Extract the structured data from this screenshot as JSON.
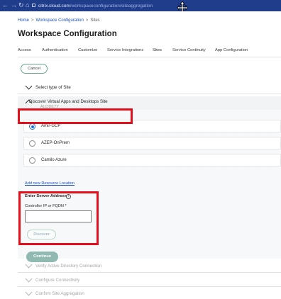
{
  "browser": {
    "url_host": "citrix.cloud.com",
    "url_path": "/workspaceconfiguration/siteaggregation",
    "back_icon": "←",
    "forward_icon": "→",
    "reload_icon": "↻",
    "home_icon": "⌂"
  },
  "breadcrumb": {
    "items": [
      "Home",
      "Workspace Configuration",
      "Sites"
    ],
    "separator": ">"
  },
  "page": {
    "title": "Workspace Configuration",
    "accent_color": "#2f9e7d",
    "highlight_color": "#e3101b"
  },
  "tabs": [
    {
      "label": "Access"
    },
    {
      "label": "Authentication"
    },
    {
      "label": "Customize"
    },
    {
      "label": "Service Integrations"
    },
    {
      "label": "Sites",
      "active": true
    },
    {
      "label": "Service Continuity"
    },
    {
      "label": "App Configuration"
    }
  ],
  "actions": {
    "cancel_label": "Cancel",
    "discover_label": "Discover",
    "continue_label": "Continue"
  },
  "sections": {
    "select_type": "Select type of Site",
    "discover": "Discover Virtual Apps and Desktops Site",
    "discover_ghost": "ALCIDILTY",
    "verify_ad": "Verify Active Directory Connection",
    "configure_connectivity": "Configure Connectivity",
    "confirm_aggregation": "Confirm Site Aggregation"
  },
  "resource_locations": [
    {
      "label": "Amir-GCP",
      "selected": true
    },
    {
      "label": "AZEP-OnPrem",
      "selected": false
    },
    {
      "label": "Camilo Azure",
      "selected": false
    }
  ],
  "add_resource_location_link": "Add new Resource Location",
  "server_form": {
    "title": "Enter Server Address",
    "info_icon": "i",
    "field_label": "Controller IP or FQDN *",
    "field_value": ""
  }
}
